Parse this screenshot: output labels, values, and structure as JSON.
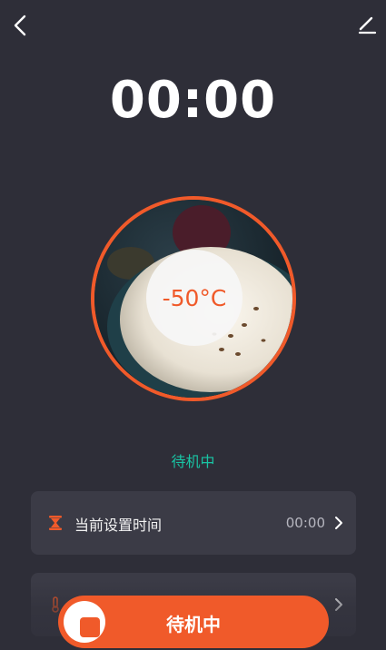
{
  "header": {
    "back_icon": "chevron-left-icon",
    "edit_icon": "pencil-icon"
  },
  "timer": {
    "display": "00:00"
  },
  "food": {
    "image": "rice-bowl-photo",
    "temperature": "-50°C",
    "ring_color": "#f05a2a"
  },
  "status": {
    "text": "待机中",
    "color": "#19c4a4"
  },
  "settings": {
    "time_row": {
      "icon": "hourglass-icon",
      "label": "当前设置时间",
      "value": "00:00"
    },
    "temp_row": {
      "icon": "thermometer-icon"
    }
  },
  "action_button": {
    "icon": "stop-icon",
    "label": "待机中",
    "color": "#f05a2a"
  },
  "colors": {
    "background": "#2e2e38",
    "card": "#3b3b46",
    "accent": "#f05a2a",
    "status": "#19c4a4"
  }
}
